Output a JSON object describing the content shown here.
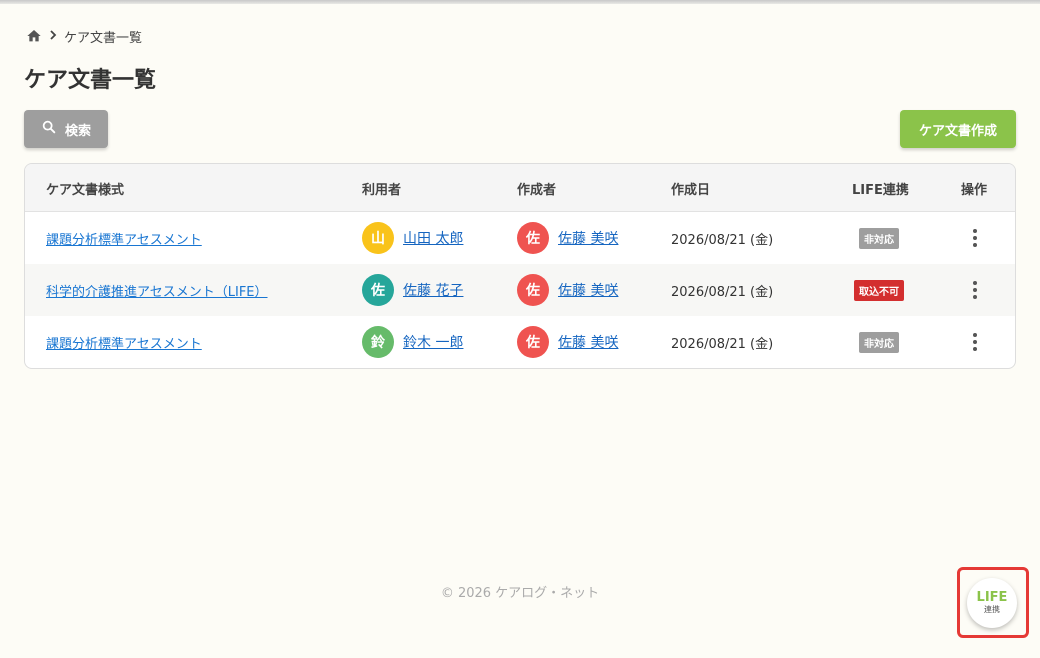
{
  "breadcrumb": {
    "home_icon": "home-icon",
    "current": "ケア文書一覧"
  },
  "page_title": "ケア文書一覧",
  "toolbar": {
    "search_label": "検索",
    "create_label": "ケア文書作成"
  },
  "colors": {
    "accent_green": "#8bc34a",
    "link_blue": "#1976d2",
    "highlight_red": "#e53935"
  },
  "table": {
    "headers": {
      "template": "ケア文書様式",
      "user": "利用者",
      "author": "作成者",
      "date": "作成日",
      "life": "LIFE連携",
      "actions": "操作"
    },
    "rows": [
      {
        "template": "課題分析標準アセスメント",
        "user": {
          "initial": "山",
          "name": "山田 太郎",
          "color": "#f9c31b"
        },
        "author": {
          "initial": "佐",
          "name": "佐藤 美咲",
          "color": "#ef5350"
        },
        "date": "2026/08/21 (金)",
        "life": {
          "label": "非対応",
          "color": "#9e9e9e"
        }
      },
      {
        "template": "科学的介護推進アセスメント（LIFE）",
        "user": {
          "initial": "佐",
          "name": "佐藤 花子",
          "color": "#26a69a"
        },
        "author": {
          "initial": "佐",
          "name": "佐藤 美咲",
          "color": "#ef5350"
        },
        "date": "2026/08/21 (金)",
        "life": {
          "label": "取込不可",
          "color": "#d32f2f"
        }
      },
      {
        "template": "課題分析標準アセスメント",
        "user": {
          "initial": "鈴",
          "name": "鈴木 一郎",
          "color": "#66bb6a"
        },
        "author": {
          "initial": "佐",
          "name": "佐藤 美咲",
          "color": "#ef5350"
        },
        "date": "2026/08/21 (金)",
        "life": {
          "label": "非対応",
          "color": "#9e9e9e"
        }
      }
    ]
  },
  "footer": {
    "copyright": "© 2026 ケアログ・ネット"
  },
  "life_button": {
    "line1": "LIFE",
    "line2": "連携"
  }
}
